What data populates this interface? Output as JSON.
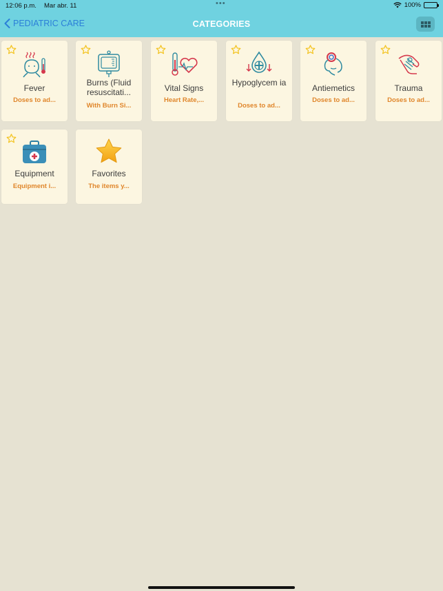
{
  "status_bar": {
    "time": "12:06 p.m.",
    "date": "Mar abr. 11",
    "battery": "100%"
  },
  "nav": {
    "back_label": "PEDIATRIC CARE",
    "title": "CATEGORIES"
  },
  "colors": {
    "header": "#6fd2e0",
    "background": "#e6e2d2",
    "tile": "#fcf6e1",
    "accent_orange": "#e0862b",
    "link_blue": "#2b7fd8",
    "star_yellow": "#f3c21b"
  },
  "categories": [
    {
      "name": "Fever",
      "subtitle": "Doses to ad...",
      "icon": "fever-child-thermometer-icon",
      "favoritable": true
    },
    {
      "name": "Burns (Fluid resuscitati...",
      "subtitle": "With Burn Si...",
      "icon": "iv-bag-icon",
      "favoritable": true
    },
    {
      "name": "Vital Signs",
      "subtitle": "Heart Rate,...",
      "icon": "thermometer-heart-icon",
      "favoritable": true
    },
    {
      "name": "Hypoglycem ia",
      "subtitle": "Doses to ad...",
      "icon": "glucose-drop-icon",
      "favoritable": true
    },
    {
      "name": "Antiemetics",
      "subtitle": "Doses to ad...",
      "icon": "nausea-head-icon",
      "favoritable": true
    },
    {
      "name": "Trauma",
      "subtitle": "Doses to ad...",
      "icon": "bandaged-arm-icon",
      "favoritable": true
    },
    {
      "name": "Equipment",
      "subtitle": "Equipment i...",
      "icon": "first-aid-kit-icon",
      "favoritable": true
    },
    {
      "name": "Favorites",
      "subtitle": "The items y...",
      "icon": "star-icon",
      "favoritable": false
    }
  ]
}
